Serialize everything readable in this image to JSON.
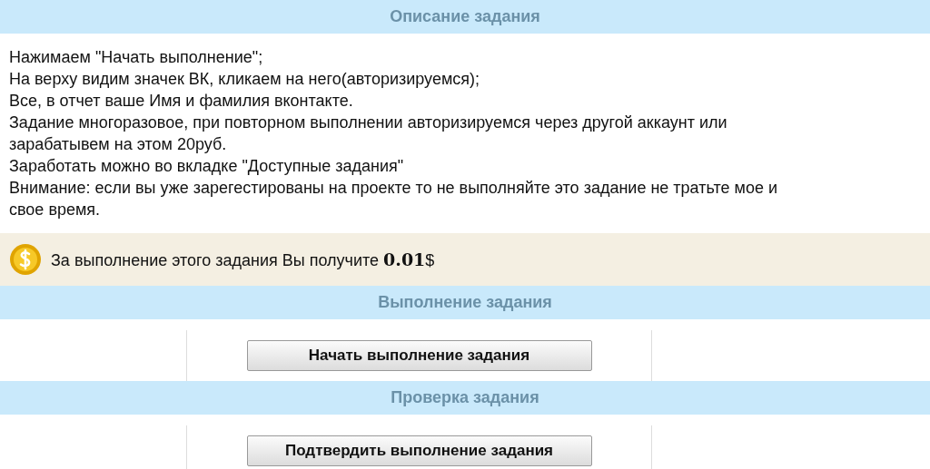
{
  "sections": [
    {
      "kind": "description",
      "heading": "Описание задания",
      "lines": [
        "Нажимаем \"Начать выполнение\";",
        "На верху видим значек ВК, кликаем на него(авторизируемся);",
        "Все, в отчет ваше Имя и фамилия вконтакте.",
        "Задание многоразовое, при повторном выполнении авторизируемся через другой аккаунт или",
        "зарабатывем на этом 20руб.",
        "Заработать можно во вкладке \"Доступные задания\"",
        "Внимание: если вы уже зарегестированы на проекте то не выполняйте это задание не тратьте мое и",
        "свое время."
      ],
      "reward": "За выполнение этого задания Вы получите **0.01**$"
    },
    {
      "kind": "action",
      "heading": "Выполнение задания",
      "button": "Начать выполнение задания"
    },
    {
      "kind": "action",
      "heading": "Проверка задания",
      "button": "Подтвердить выполнение задания"
    }
  ]
}
